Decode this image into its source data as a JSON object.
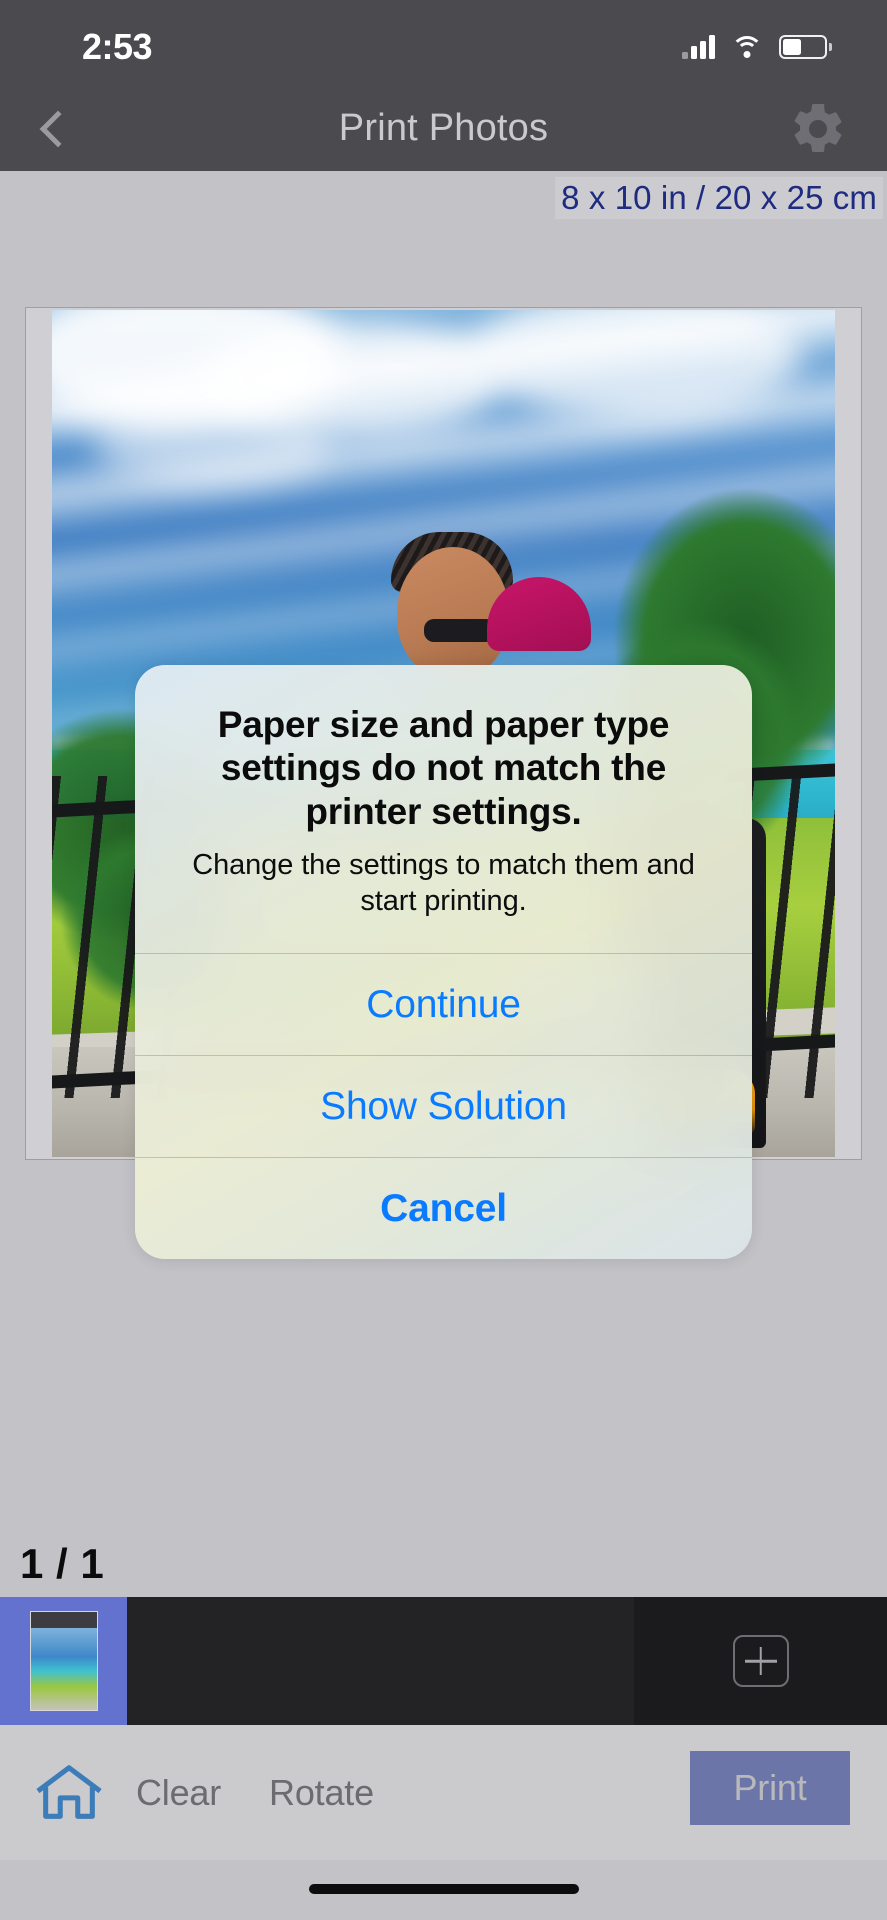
{
  "status_bar": {
    "time": "2:53",
    "signal_icon": "cellular-signal-icon",
    "wifi_icon": "wifi-icon",
    "battery_icon": "battery-icon"
  },
  "nav_bar": {
    "back_icon": "chevron-left-icon",
    "title": "Print Photos",
    "settings_icon": "gear-icon"
  },
  "preview": {
    "paper_size_label": "8 x 10 in / 20 x 25 cm",
    "page_counter": "1 / 1"
  },
  "alert": {
    "title": "Paper size and paper type settings do not match the printer settings.",
    "message": "Change the settings to match them and start printing.",
    "buttons": [
      {
        "label": "Continue",
        "style": "regular"
      },
      {
        "label": "Show Solution",
        "style": "regular"
      },
      {
        "label": "Cancel",
        "style": "bold"
      }
    ]
  },
  "filmstrip": {
    "thumbnail_name": "photo-thumbnail",
    "add_button_icon": "plus-icon"
  },
  "toolbar": {
    "home_icon": "home-icon",
    "clear_label": "Clear",
    "rotate_label": "Rotate",
    "print_label": "Print"
  },
  "colors": {
    "nav_background": "#4A4A4F",
    "page_background": "#C2C2C7",
    "toolbar_background": "#CBCBCE",
    "accent_blue": "#0A7BFF",
    "paper_size_text": "#1F2B80",
    "home_icon_blue": "#3C7CB8",
    "print_button": "#6B75A8",
    "print_button_text": "#B9B9BC",
    "thumbnail_selected": "#6272CE",
    "filmstrip_background": "#232325"
  }
}
